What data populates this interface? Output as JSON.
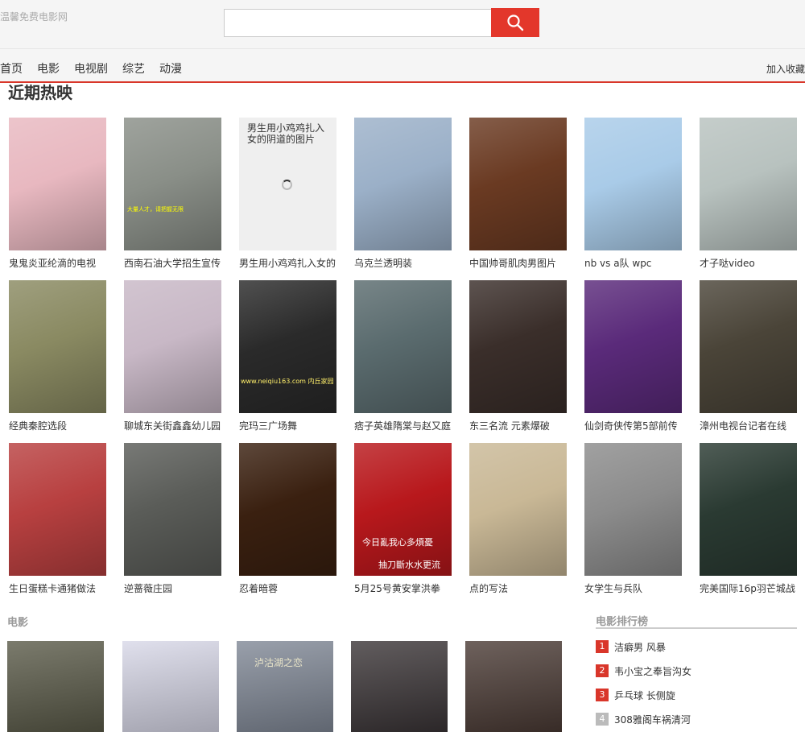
{
  "header": {
    "logo": "温馨免费电影网"
  },
  "search": {
    "placeholder": ""
  },
  "nav": {
    "items": [
      "首页",
      "电影",
      "电视剧",
      "综艺",
      "动漫"
    ],
    "favorite": "加入收藏"
  },
  "hot": {
    "title": "近期热映",
    "items": [
      {
        "title": "鬼鬼炎亚纶滴的电视",
        "color": "#e8b8c0"
      },
      {
        "title": "西南石油大学招生宣传",
        "color": "#8a8f88"
      },
      {
        "title": "男生用小鸡鸡扎入女的",
        "color": "#efefef",
        "placeholder": "男生用小鸡鸡扎入女的阴道的图片"
      },
      {
        "title": "乌克兰透明装",
        "color": "#9bb0c8"
      },
      {
        "title": "中国帅哥肌肉男图片",
        "color": "#6a3a22"
      },
      {
        "title": "nb vs a队  wpc",
        "color": "#a9cbe8"
      },
      {
        "title": "才子哒video",
        "color": "#b8c2bf"
      },
      {
        "title": "经典秦腔选段",
        "color": "#8a8a62"
      },
      {
        "title": "聊城东关街鑫鑫幼儿园",
        "color": "#c8b8c6"
      },
      {
        "title": "完玛三广场舞",
        "color": "#2a2a2a"
      },
      {
        "title": "痞子英雄隋棠与赵又庭",
        "color": "#5a6b6e"
      },
      {
        "title": "东三名流  元素爆破",
        "color": "#3a2e2a"
      },
      {
        "title": "仙剑奇侠传第5部前传",
        "color": "#5a2a7a"
      },
      {
        "title": "漳州电视台记者在线",
        "color": "#4a4438"
      },
      {
        "title": "生日蛋糕卡通猪做法",
        "color": "#b84040"
      },
      {
        "title": "逆蔷薇庄园",
        "color": "#5a5c58"
      },
      {
        "title": "忍着暗蓉",
        "color": "#3a2010"
      },
      {
        "title": "5月25号黄安掌洪拳",
        "color": "#b8181c"
      },
      {
        "title": "点的写法",
        "color": "#c9b896"
      },
      {
        "title": "女学生与兵队",
        "color": "#8c8c8c"
      },
      {
        "title": "完美国际16p羽芒城战",
        "color": "#2a3a32"
      }
    ]
  },
  "overlays": {
    "hot_2_text": "大量人才，请把握无限",
    "hot_9_text": "www.neiqiu163.com  内丘家园",
    "hot_17_line1": "今日亂我心多煩憂",
    "hot_17_line2": "抽刀斷水水更流"
  },
  "movies": {
    "title": "电影",
    "colors": [
      "#5a5a48",
      "#d8d8e8",
      "#808896",
      "#3a3436",
      "#4a3a34"
    ],
    "overlay_text": "泸沽湖之恋"
  },
  "ranking": {
    "title": "电影排行榜",
    "items": [
      {
        "num": "1",
        "label": "洁癖男  风暴",
        "color": "#d9362a"
      },
      {
        "num": "2",
        "label": "韦小宝之奉旨沟女",
        "color": "#d9362a"
      },
      {
        "num": "3",
        "label": "乒乓球  长侧旋",
        "color": "#d9362a"
      },
      {
        "num": "4",
        "label": "308雅阁车祸清河",
        "color": "#bbbbbb"
      }
    ]
  }
}
